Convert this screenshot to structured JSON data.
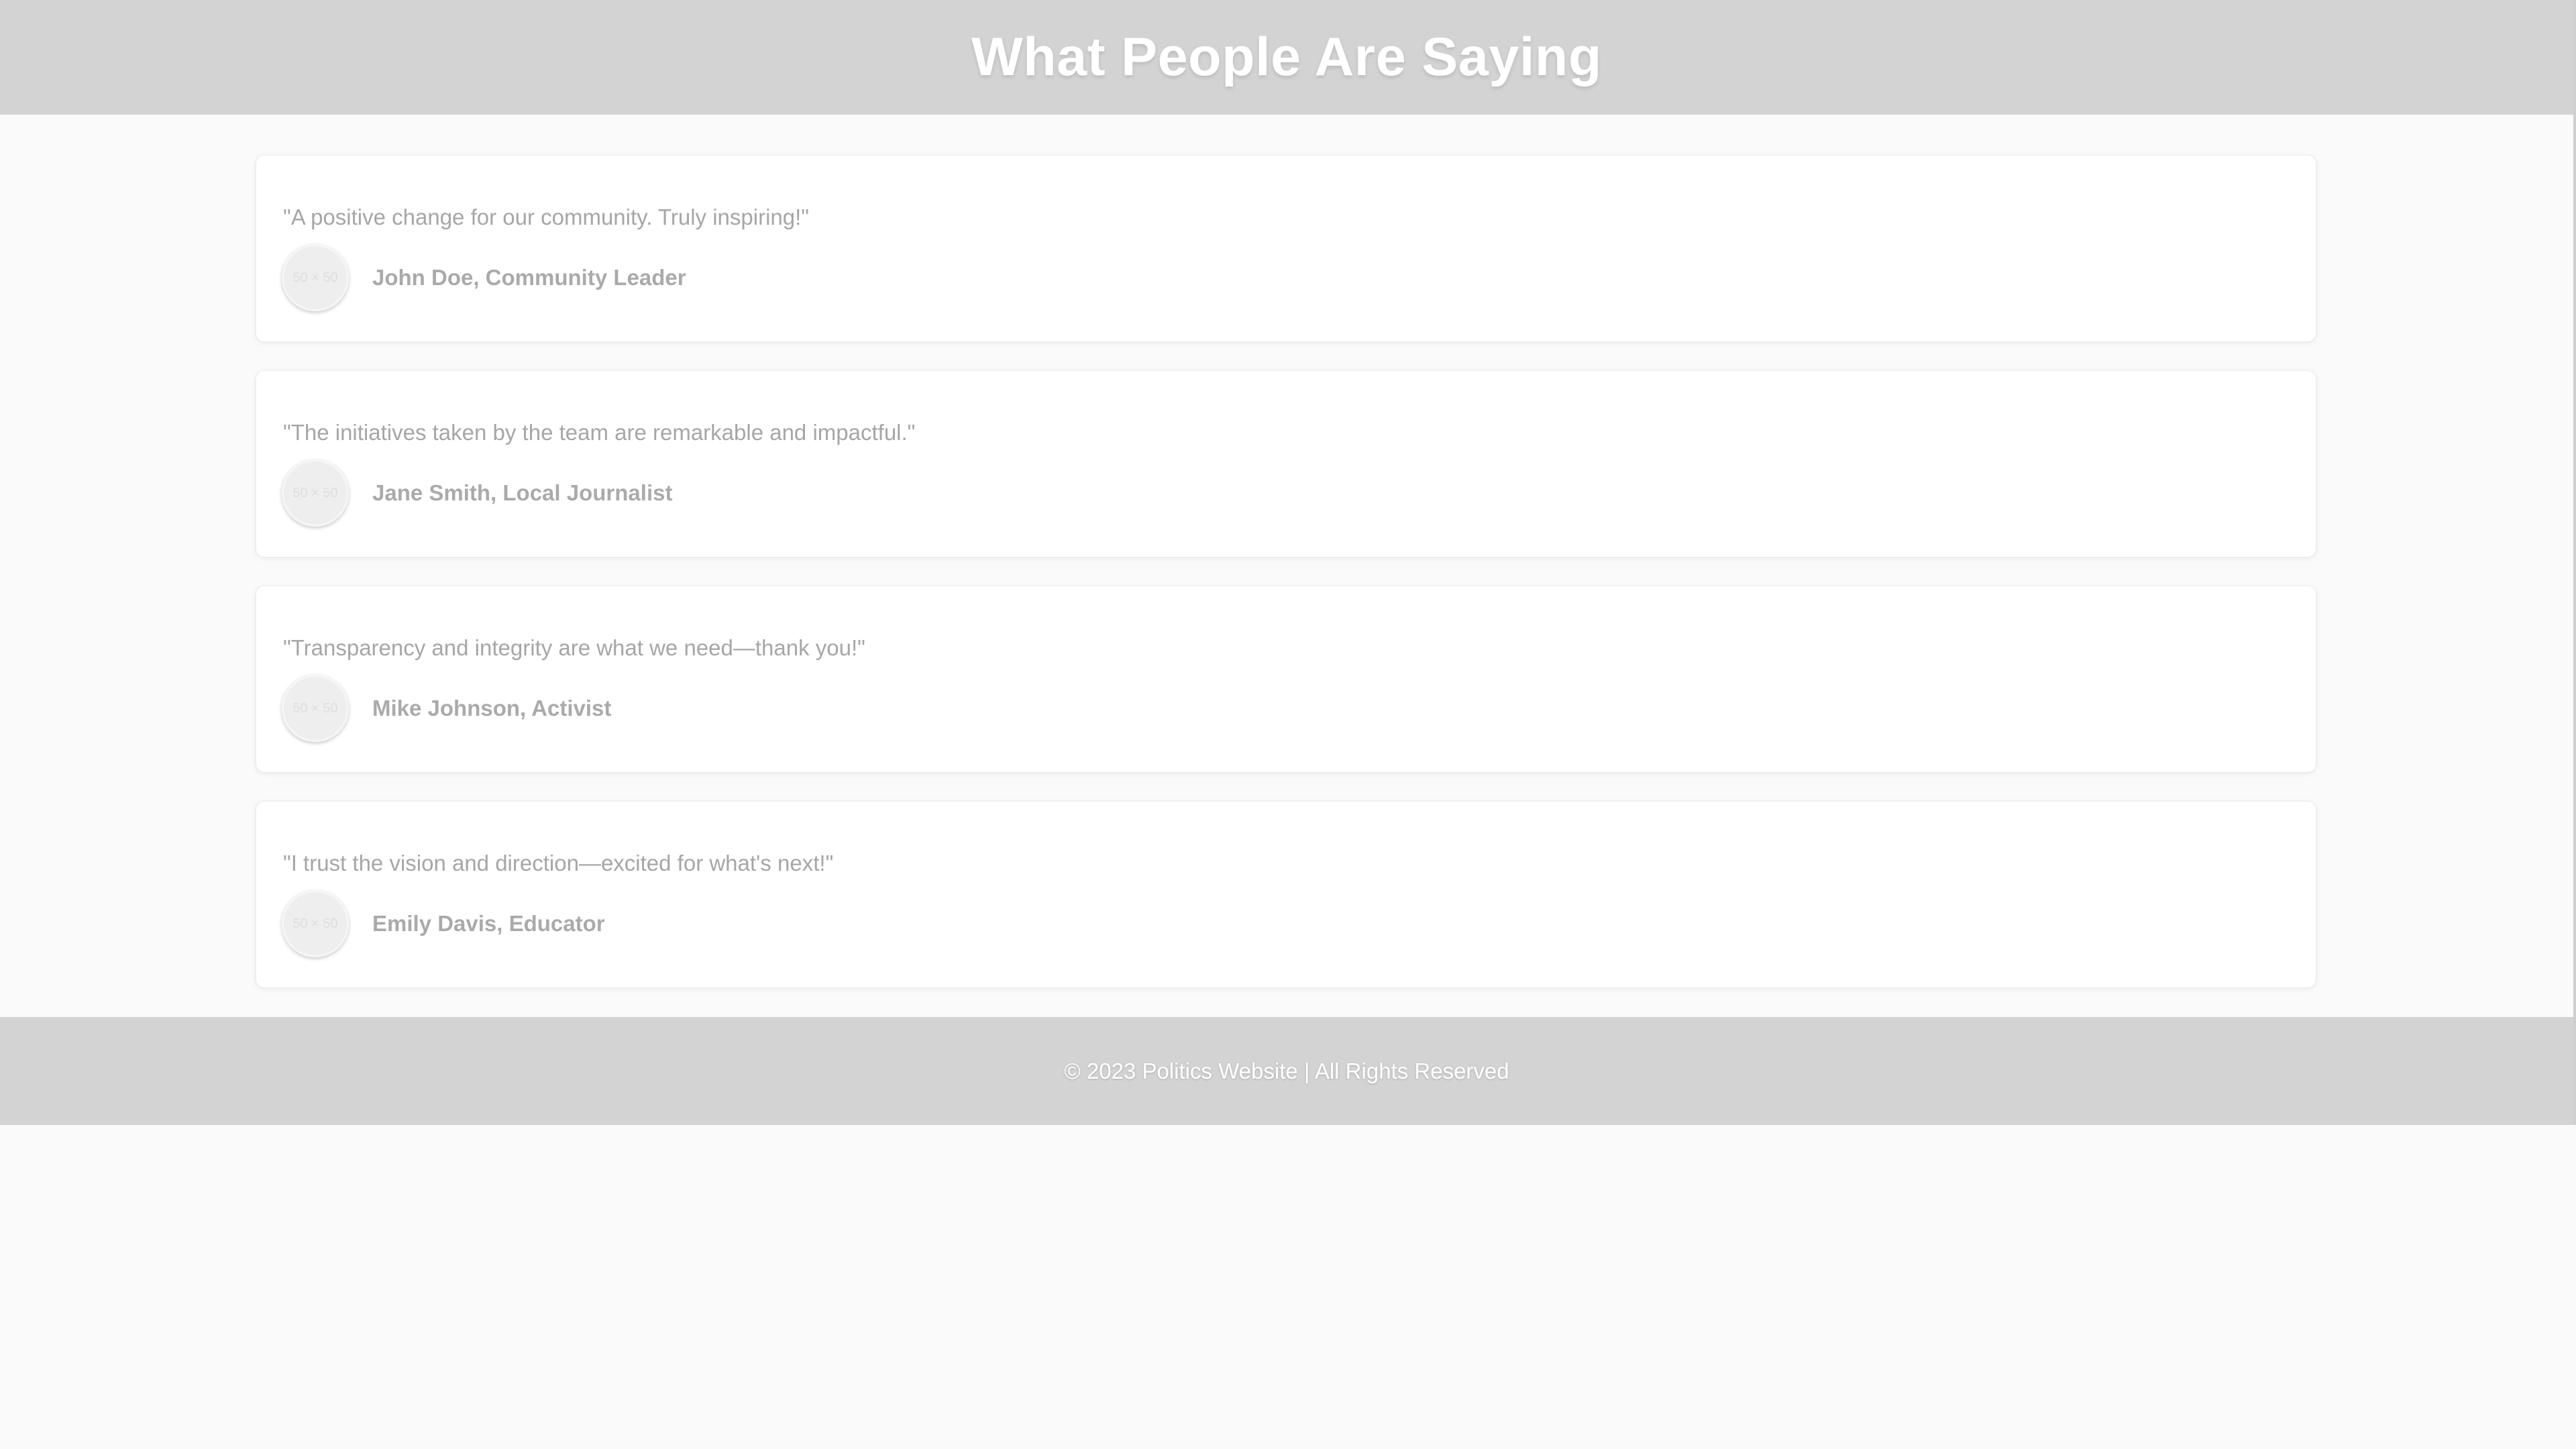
{
  "header": {
    "title": "What People Are Saying"
  },
  "testimonials": [
    {
      "quote": "\"A positive change for our community. Truly inspiring!\"",
      "author": "John Doe, Community Leader",
      "avatar_placeholder": "50 × 50"
    },
    {
      "quote": "\"The initiatives taken by the team are remarkable and impactful.\"",
      "author": "Jane Smith, Local Journalist",
      "avatar_placeholder": "50 × 50"
    },
    {
      "quote": "\"Transparency and integrity are what we need—thank you!\"",
      "author": "Mike Johnson, Activist",
      "avatar_placeholder": "50 × 50"
    },
    {
      "quote": "\"I trust the vision and direction—excited for what's next!\"",
      "author": "Emily Davis, Educator",
      "avatar_placeholder": "50 × 50"
    }
  ],
  "footer": {
    "text": "© 2023 Politics Website | All Rights Reserved"
  },
  "colors": {
    "header_bg": "#d3d3d3",
    "footer_bg": "#d3d3d3",
    "page_bg": "#fafafa",
    "card_bg": "#ffffff",
    "text_muted": "#a6a6a6"
  }
}
